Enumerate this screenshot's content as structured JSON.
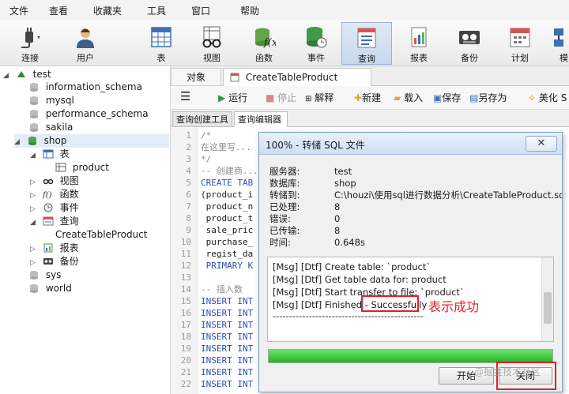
{
  "menu": [
    "文件",
    "查看",
    "收藏夹",
    "工具",
    "窗口",
    "帮助"
  ],
  "toolbar": [
    {
      "label": "连接",
      "icon": "plug-icon"
    },
    {
      "label": "用户",
      "icon": "user-icon"
    },
    {
      "label": "表",
      "icon": "table-icon"
    },
    {
      "label": "视图",
      "icon": "view-glasses-icon"
    },
    {
      "label": "函数",
      "icon": "function-icon"
    },
    {
      "label": "事件",
      "icon": "event-db-icon"
    },
    {
      "label": "查询",
      "icon": "query-icon",
      "active": true
    },
    {
      "label": "报表",
      "icon": "report-icon"
    },
    {
      "label": "备份",
      "icon": "backup-tape-icon"
    },
    {
      "label": "计划",
      "icon": "schedule-calendar-icon"
    },
    {
      "label": "模",
      "icon": "model-icon"
    }
  ],
  "tree": {
    "connection": "test",
    "databases": [
      "information_schema",
      "mysql",
      "performance_schema",
      "sakila"
    ],
    "open_db": "shop",
    "table_group": "表",
    "table": "product",
    "groups": [
      "视图",
      "函数",
      "事件"
    ],
    "query_group": "查询",
    "query": "CreateTableProduct",
    "report_group": "报表",
    "backup_group": "备份",
    "after": [
      "sys",
      "world"
    ]
  },
  "tabs": {
    "objects": "对象",
    "active": "CreateTableProduct @shop..."
  },
  "editor_toolbar": {
    "run": "运行",
    "stop": "停止",
    "explain": "解释",
    "new": "新建",
    "load": "载入",
    "save": "保存",
    "save_as": "另存为",
    "beautify": "美化 S"
  },
  "subtabs": [
    "查询创建工具",
    "查询编辑器"
  ],
  "code_lines": [
    {
      "n": "1",
      "t": "/*",
      "c": "cmt"
    },
    {
      "n": "2",
      "t": "在这里写...",
      "c": "cmt"
    },
    {
      "n": "3",
      "t": "*/",
      "c": "cmt"
    },
    {
      "n": "4",
      "t": "-- 创建商...",
      "c": "cmt"
    },
    {
      "n": "5",
      "t": "CREATE TAB",
      "c": "kw"
    },
    {
      "n": "6",
      "t": "(product_i",
      "c": ""
    },
    {
      "n": "7",
      "t": " product_n",
      "c": ""
    },
    {
      "n": "8",
      "t": " product_t",
      "c": ""
    },
    {
      "n": "9",
      "t": " sale_pric",
      "c": ""
    },
    {
      "n": "10",
      "t": " purchase_",
      "c": ""
    },
    {
      "n": "11",
      "t": " regist_da",
      "c": ""
    },
    {
      "n": "12",
      "t": " PRIMARY K",
      "c": "kw"
    },
    {
      "n": "13",
      "t": "",
      "c": ""
    },
    {
      "n": "14",
      "t": "-- 插入数",
      "c": "cmt"
    },
    {
      "n": "15",
      "t": "INSERT INT",
      "c": "kw"
    },
    {
      "n": "16",
      "t": "INSERT INT",
      "c": "kw"
    },
    {
      "n": "17",
      "t": "INSERT INT",
      "c": "kw"
    },
    {
      "n": "18",
      "t": "INSERT INT",
      "c": "kw"
    },
    {
      "n": "19",
      "t": "INSERT INT",
      "c": "kw"
    },
    {
      "n": "20",
      "t": "INSERT INT",
      "c": "kw"
    },
    {
      "n": "21",
      "t": "INSERT INT",
      "c": "kw"
    },
    {
      "n": "22",
      "t": "INSERT INT",
      "c": "kw"
    }
  ],
  "dialog": {
    "title": "100% - 转储 SQL 文件",
    "close_glyph": "✕",
    "fields": [
      {
        "k": "服务器:",
        "v": "test"
      },
      {
        "k": "数据库:",
        "v": "shop"
      },
      {
        "k": "转储到:",
        "v": "C:\\houzi\\使用sql进行数据分析\\CreateTableProduct.sql"
      },
      {
        "k": "已处理:",
        "v": "8"
      },
      {
        "k": "错误:",
        "v": "0"
      },
      {
        "k": "已传输:",
        "v": "8"
      },
      {
        "k": "时间:",
        "v": "0.648s"
      }
    ],
    "log": [
      "[Msg] [Dtf] Create table: `product`",
      "[Msg] [Dtf] Get table data for: product",
      "[Msg] [Dtf] Start transfer to file: `product`"
    ],
    "finished_prefix": "[Msg] [Dtf] Finished - ",
    "finished_status": "Successfully",
    "separator": "----------------------------------------------",
    "progress_percent": 100,
    "start_button": "开始",
    "close_button": "关闭"
  },
  "annotation": "表示成功",
  "watermark": "@掘金技术社区",
  "colors": {
    "accent_red": "#e0202a",
    "progress_green": "#22b522",
    "active_tool": "#c7d8ef"
  }
}
